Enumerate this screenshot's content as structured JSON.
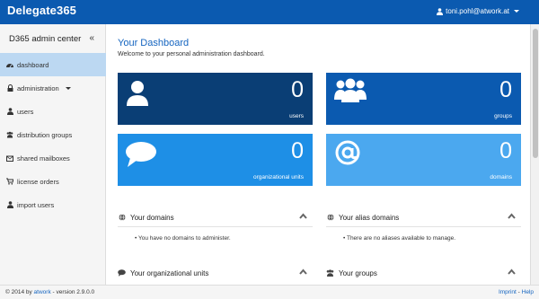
{
  "app": {
    "brand": "Delegate365",
    "user": "toni.pohl@atwork.at"
  },
  "sidebar": {
    "title": "D365 admin center",
    "collapse_glyph": "«",
    "items": [
      {
        "label": "dashboard",
        "icon": "dashboard-icon"
      },
      {
        "label": "administration",
        "icon": "lock-icon"
      },
      {
        "label": "users",
        "icon": "user-icon"
      },
      {
        "label": "distribution groups",
        "icon": "group-icon"
      },
      {
        "label": "shared mailboxes",
        "icon": "mailboxes-icon"
      },
      {
        "label": "license orders",
        "icon": "cart-icon"
      },
      {
        "label": "import users",
        "icon": "import-user-icon"
      }
    ]
  },
  "dashboard": {
    "title": "Your Dashboard",
    "subtitle": "Welcome to your personal administration dashboard.",
    "tiles": [
      {
        "count": "0",
        "label": "users",
        "color": "#0a3e75",
        "icon": "user-icon"
      },
      {
        "count": "0",
        "label": "groups",
        "color": "#0b5ab0",
        "icon": "group-icon"
      },
      {
        "count": "0",
        "label": "organizational units",
        "color": "#1e8fe6",
        "icon": "speech-bubble-icon"
      },
      {
        "count": "0",
        "label": "domains",
        "color": "#4ba8ef",
        "icon": "at-icon"
      }
    ],
    "panels": {
      "domains": {
        "title": "Your domains",
        "message": "You have no domains to administer."
      },
      "aliases": {
        "title": "Your alias domains",
        "message": "There are no aliases available to manage."
      },
      "orgunits": {
        "title": "Your organizational units"
      },
      "groups": {
        "title": "Your groups"
      }
    }
  },
  "footer": {
    "copyright": "© 2014 by",
    "company": "atwork",
    "version": "- version 2.9.0.0",
    "imprint": "Imprint",
    "separator": "-",
    "help": "Help"
  }
}
